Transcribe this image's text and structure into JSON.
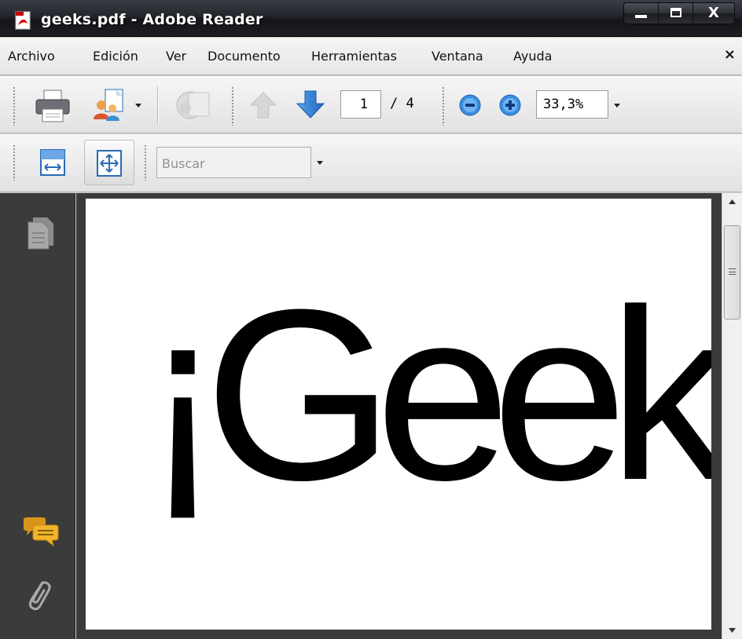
{
  "window": {
    "title": "geeks.pdf - Adobe Reader",
    "minimize_label": "",
    "maximize_label": "",
    "close_label": "X"
  },
  "menu": {
    "items": [
      "Archivo",
      "Edición",
      "Ver",
      "Documento",
      "Herramientas",
      "Ventana",
      "Ayuda"
    ],
    "close_label": "×"
  },
  "toolbar": {
    "current_page": "1",
    "page_count": "/ 4",
    "zoom": "33,3%",
    "search_placeholder": "Buscar",
    "icons": [
      "print-icon",
      "collaborate-icon",
      "share-icon",
      "previous-page-icon",
      "next-page-icon",
      "zoom-out-icon",
      "zoom-in-icon",
      "fit-width-icon",
      "fit-page-icon"
    ]
  },
  "nav": {
    "icons": [
      "pages-icon",
      "comments-icon",
      "attachments-icon"
    ]
  },
  "document": {
    "visible_text": "¡Geeka"
  },
  "colors": {
    "titlebar": "#1d1f24",
    "nav_pane": "#3b3b3b",
    "page": "#ffffff",
    "accent_blue": "#2f7fd8",
    "comments_yellow": "#e9a71d"
  }
}
